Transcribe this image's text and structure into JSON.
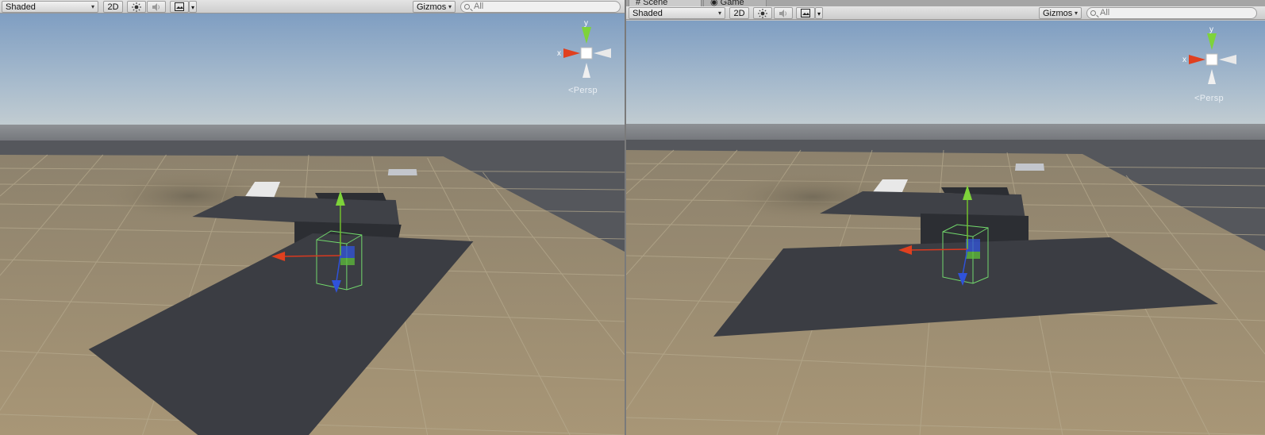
{
  "left_view": {
    "toolbar": {
      "draw_mode": "Shaded",
      "toggle_2d": "2D",
      "gizmos_label": "Gizmos",
      "search_placeholder": "All",
      "icons": [
        "sun-lighting-icon",
        "audio-speaker-icon",
        "image-effects-icon",
        "chevron-down-icon"
      ]
    },
    "gizmo": {
      "y_label": "y",
      "x_label": "x"
    },
    "projection_label": "Persp"
  },
  "right_view": {
    "tabs": [
      {
        "label": "Scene",
        "icon": "scene-hash-icon",
        "active": true
      },
      {
        "label": "Game",
        "icon": "game-controller-icon",
        "active": false
      }
    ],
    "toolbar": {
      "draw_mode": "Shaded",
      "toggle_2d": "2D",
      "gizmos_label": "Gizmos",
      "search_placeholder": "All",
      "icons": [
        "sun-lighting-icon",
        "audio-speaker-icon",
        "image-effects-icon",
        "chevron-down-icon"
      ]
    },
    "gizmo": {
      "y_label": "y",
      "x_label": "x"
    },
    "projection_label": "Persp"
  },
  "colors": {
    "sky_top": "#7d9cc0",
    "sky_horizon": "#c9d3d7",
    "ground": "#9c8b67",
    "grid_line": "#b9ad91",
    "dark_plane": "#3a3c42",
    "axis_x": "#d9391f",
    "axis_y": "#72c02c",
    "axis_z": "#2f52d9",
    "bounds_box": "#6fdc6f"
  }
}
